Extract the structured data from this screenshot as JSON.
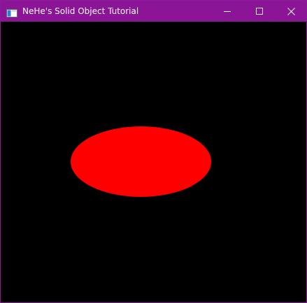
{
  "window": {
    "title": "NeHe's Solid Object Tutorial",
    "titlebar_color": "#8b1596",
    "background_color": "#000000"
  },
  "controls": {
    "minimize_icon": "minimize-icon",
    "maximize_icon": "maximize-icon",
    "close_icon": "close-icon"
  },
  "scene": {
    "shape": "ellipse",
    "color": "#ff0000"
  }
}
